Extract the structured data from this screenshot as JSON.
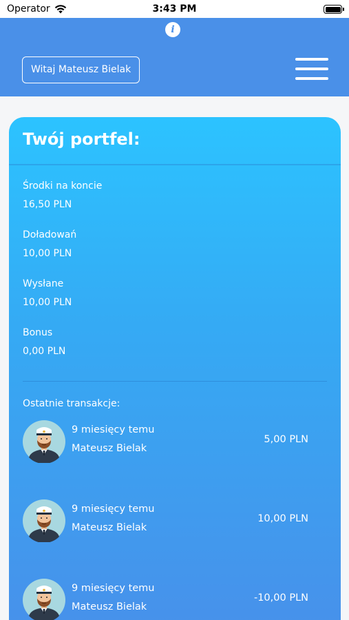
{
  "status_bar": {
    "carrier": "Operator",
    "time": "3:43 PM"
  },
  "header": {
    "greeting": "Witaj Mateusz Bielak",
    "info_icon": "info-icon",
    "menu_icon": "hamburger-menu-icon",
    "background": "#4a90e8"
  },
  "wallet": {
    "title": "Twój portfel:",
    "stats": [
      {
        "label": "Środki na koncie",
        "value": "16,50 PLN"
      },
      {
        "label": "Doładowań",
        "value": "10,00 PLN"
      },
      {
        "label": "Wysłane",
        "value": "10,00 PLN"
      },
      {
        "label": "Bonus",
        "value": "0,00 PLN"
      }
    ],
    "transactions_heading": "Ostatnie transakcje:",
    "transactions": [
      {
        "date": "9 miesięcy temu",
        "name": "Mateusz Bielak",
        "amount": "5,00 PLN"
      },
      {
        "date": "9 miesięcy temu",
        "name": "Mateusz Bielak",
        "amount": "10,00 PLN"
      },
      {
        "date": "9 miesięcy temu",
        "name": "Mateusz Bielak",
        "amount": "-10,00 PLN"
      }
    ]
  }
}
